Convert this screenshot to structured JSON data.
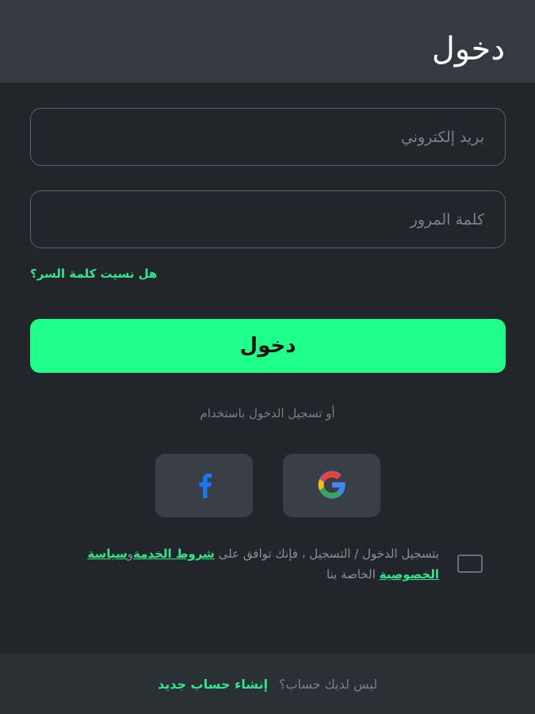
{
  "header": {
    "title": "دخول"
  },
  "form": {
    "email_placeholder": "بريد إلكتروني",
    "password_placeholder": "كلمة المرور",
    "forgot_password": "هل نسيت كلمة السر؟",
    "login_button": "دخول"
  },
  "social": {
    "or_text": "أو تسجيل الدخول باستخدام",
    "buttons": [
      {
        "provider": "facebook",
        "icon": "facebook-icon",
        "color": "#1877f2"
      },
      {
        "provider": "google",
        "icon": "google-icon",
        "colors": [
          "#4285f4",
          "#ea4335",
          "#fbbc05",
          "#34a853"
        ]
      }
    ]
  },
  "terms": {
    "prefix": "بتسجيل الدخول / التسجيل ، فإنك توافق على ",
    "terms_link": "شروط الخدمة",
    "connector": "و",
    "privacy_link": "سياسة الخصوصية",
    "suffix": " الخاصة بنا",
    "checked": false
  },
  "footer": {
    "question": "ليس لديك حساب؟",
    "signup_link": "إنشاء حساب جديد"
  },
  "colors": {
    "background": "#23252c",
    "header": "#343a42",
    "accent": "#1dff88",
    "link": "#2ee88a"
  }
}
